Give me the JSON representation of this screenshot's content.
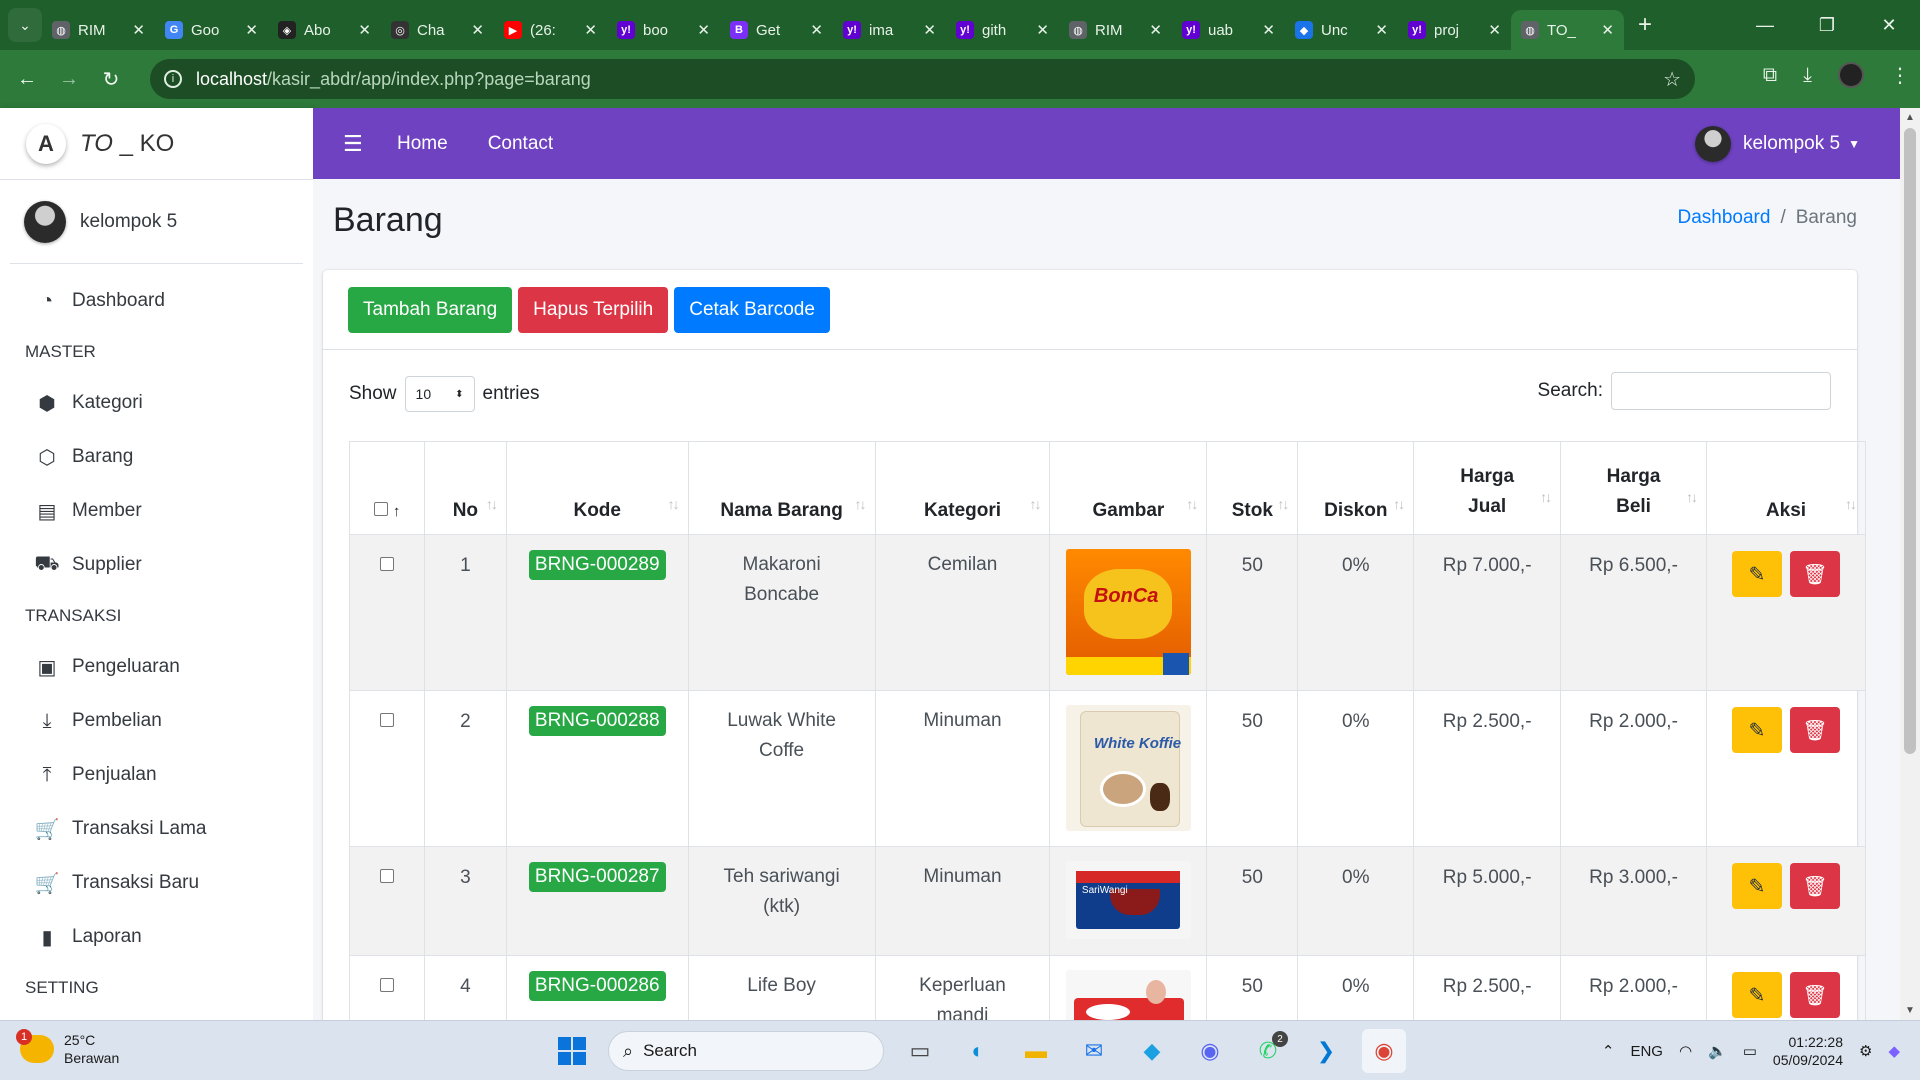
{
  "browser": {
    "tabs": [
      {
        "title": "RIM",
        "color": "#5f6368",
        "glyph": "◍"
      },
      {
        "title": "Goo",
        "color": "#4285f4",
        "glyph": "G"
      },
      {
        "title": "Abo",
        "color": "#222222",
        "glyph": "◈"
      },
      {
        "title": "Cha",
        "color": "#333333",
        "glyph": "◎"
      },
      {
        "title": "(26:",
        "color": "#ff0000",
        "glyph": "▶"
      },
      {
        "title": "boo",
        "color": "#6001d2",
        "glyph": "y!"
      },
      {
        "title": "Get",
        "color": "#7b2ff7",
        "glyph": "B"
      },
      {
        "title": "ima",
        "color": "#6001d2",
        "glyph": "y!"
      },
      {
        "title": "gith",
        "color": "#6001d2",
        "glyph": "y!"
      },
      {
        "title": "RIM",
        "color": "#5f6368",
        "glyph": "◍"
      },
      {
        "title": "uab",
        "color": "#6001d2",
        "glyph": "y!"
      },
      {
        "title": "Unc",
        "color": "#1a73e8",
        "glyph": "◆"
      },
      {
        "title": "proj",
        "color": "#6001d2",
        "glyph": "y!"
      },
      {
        "title": "TO_",
        "color": "#5f6368",
        "glyph": "◍"
      }
    ],
    "url_host": "localhost",
    "url_path": "/kasir_abdr/app/index.php?page=barang"
  },
  "brand": {
    "logo": "A",
    "text_a": "TO",
    "text_b": " _ KO"
  },
  "sidebar": {
    "user": "kelompok 5",
    "items": [
      {
        "type": "item",
        "icon": "◔",
        "icon_name": "dashboard-icon",
        "label": "Dashboard"
      },
      {
        "type": "header",
        "label": "MASTER"
      },
      {
        "type": "item",
        "icon": "⬢",
        "icon_name": "box-icon",
        "label": "Kategori"
      },
      {
        "type": "item",
        "icon": "⬡",
        "icon_name": "boxes-icon",
        "label": "Barang"
      },
      {
        "type": "item",
        "icon": "▤",
        "icon_name": "id-card-icon",
        "label": "Member"
      },
      {
        "type": "item",
        "icon": "⛟",
        "icon_name": "truck-icon",
        "label": "Supplier"
      },
      {
        "type": "header",
        "label": "TRANSAKSI"
      },
      {
        "type": "item",
        "icon": "▣",
        "icon_name": "money-icon",
        "label": "Pengeluaran"
      },
      {
        "type": "item",
        "icon": "⤓",
        "icon_name": "download-icon",
        "label": "Pembelian"
      },
      {
        "type": "item",
        "icon": "⤒",
        "icon_name": "upload-icon",
        "label": "Penjualan"
      },
      {
        "type": "item",
        "icon": "🛒",
        "icon_name": "cart-icon",
        "label": "Transaksi Lama"
      },
      {
        "type": "item",
        "icon": "🛒",
        "icon_name": "cart-icon",
        "label": "Transaksi Baru"
      },
      {
        "type": "item",
        "icon": "▮",
        "icon_name": "file-icon",
        "label": "Laporan"
      },
      {
        "type": "header",
        "label": "SETTING"
      }
    ]
  },
  "topnav": {
    "home": "Home",
    "contact": "Contact",
    "user": "kelompok 5"
  },
  "page": {
    "title": "Barang",
    "breadcrumb_link": "Dashboard",
    "breadcrumb_sep": "/",
    "breadcrumb_current": "Barang"
  },
  "actions": {
    "add": "Tambah Barang",
    "delete_selected": "Hapus Terpilih",
    "print_barcode": "Cetak Barcode"
  },
  "datatable": {
    "show_label": "Show",
    "length_value": "10",
    "entries_label": "entries",
    "search_label": "Search:",
    "columns": [
      "No",
      "Kode",
      "Nama Barang",
      "Kategori",
      "Gambar",
      "Stok",
      "Diskon",
      "Harga Jual",
      "Harga Beli",
      "Aksi"
    ],
    "rows": [
      {
        "no": "1",
        "kode": "BRNG-000289",
        "nama": "Makaroni Boncabe",
        "kategori": "Cemilan",
        "image": "makaroni",
        "stok": "50",
        "diskon": "0%",
        "harga_jual": "Rp 7.000,-",
        "harga_beli": "Rp 6.500,-"
      },
      {
        "no": "2",
        "kode": "BRNG-000288",
        "nama": "Luwak White Coffe",
        "kategori": "Minuman",
        "image": "coffee",
        "stok": "50",
        "diskon": "0%",
        "harga_jual": "Rp 2.500,-",
        "harga_beli": "Rp 2.000,-"
      },
      {
        "no": "3",
        "kode": "BRNG-000287",
        "nama": "Teh sariwangi (ktk)",
        "kategori": "Minuman",
        "image": "tea",
        "stok": "50",
        "diskon": "0%",
        "harga_jual": "Rp 5.000,-",
        "harga_beli": "Rp 3.000,-"
      },
      {
        "no": "4",
        "kode": "BRNG-000286",
        "nama": "Life Boy",
        "kategori": "Keperluan mandi",
        "image": "soap",
        "stok": "50",
        "diskon": "0%",
        "harga_jual": "Rp 2.500,-",
        "harga_beli": "Rp 2.000,-"
      }
    ]
  },
  "taskbar": {
    "temp": "25°C",
    "weather": "Berawan",
    "weather_badge": "1",
    "search": "Search",
    "whatsapp_count": "2",
    "lang": "ENG",
    "time": "01:22:28",
    "date": "05/09/2024"
  }
}
